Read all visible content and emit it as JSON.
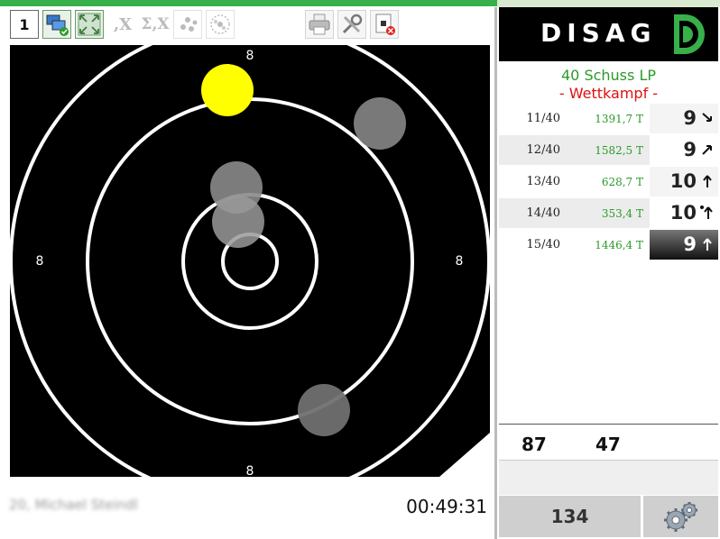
{
  "toolbar": {
    "series_number": "1",
    "buttons": [
      {
        "name": "network-status-button",
        "icon": "network-check-icon"
      },
      {
        "name": "zoom-fit-button",
        "icon": "zoom-fit-icon"
      },
      {
        "name": "decimal-x-button",
        "icon": "decimal-x-icon",
        "label": ",X"
      },
      {
        "name": "sum-x-button",
        "icon": "sum-x-icon",
        "label": "Σ,X"
      },
      {
        "name": "group-button",
        "icon": "shot-group-icon"
      },
      {
        "name": "center-button",
        "icon": "group-center-icon"
      },
      {
        "name": "print-button",
        "icon": "printer-icon"
      },
      {
        "name": "tools-button",
        "icon": "tools-icon"
      },
      {
        "name": "target-close-button",
        "icon": "target-close-icon"
      }
    ]
  },
  "target": {
    "ring_labels": {
      "top": "8",
      "bottom": "8",
      "left": "8",
      "right": "8"
    },
    "colors": {
      "background": "#000000",
      "ring": "#ffffff",
      "last_shot": "#ffff00",
      "shot": "#808080"
    }
  },
  "footer": {
    "shooter_name": "20, Michael Steindl",
    "timer": "00:49:31"
  },
  "panel": {
    "logo": "DISAG",
    "discipline": "40 Schuss LP",
    "mode": "- Wettkampf -",
    "shots": [
      {
        "num": "11/40",
        "tval": "1391,7 T",
        "score": "9",
        "dir": "arrow-down-right-icon"
      },
      {
        "num": "12/40",
        "tval": "1582,5 T",
        "score": "9",
        "dir": "arrow-up-right-icon"
      },
      {
        "num": "13/40",
        "tval": "628,7 T",
        "score": "10",
        "dir": "arrow-up-icon"
      },
      {
        "num": "14/40",
        "tval": "353,4 T",
        "score": "10",
        "dir": "arrow-up-icon"
      },
      {
        "num": "15/40",
        "tval": "1446,4 T",
        "score": "9",
        "dir": "arrow-up-icon"
      }
    ],
    "series_sum_1": "87",
    "series_sum_2": "47",
    "total": "134",
    "settings_icon": "gears-icon"
  },
  "colors": {
    "accent_green": "#37b049",
    "mode_red": "#e01010",
    "tval_green": "#2a9a2a"
  }
}
